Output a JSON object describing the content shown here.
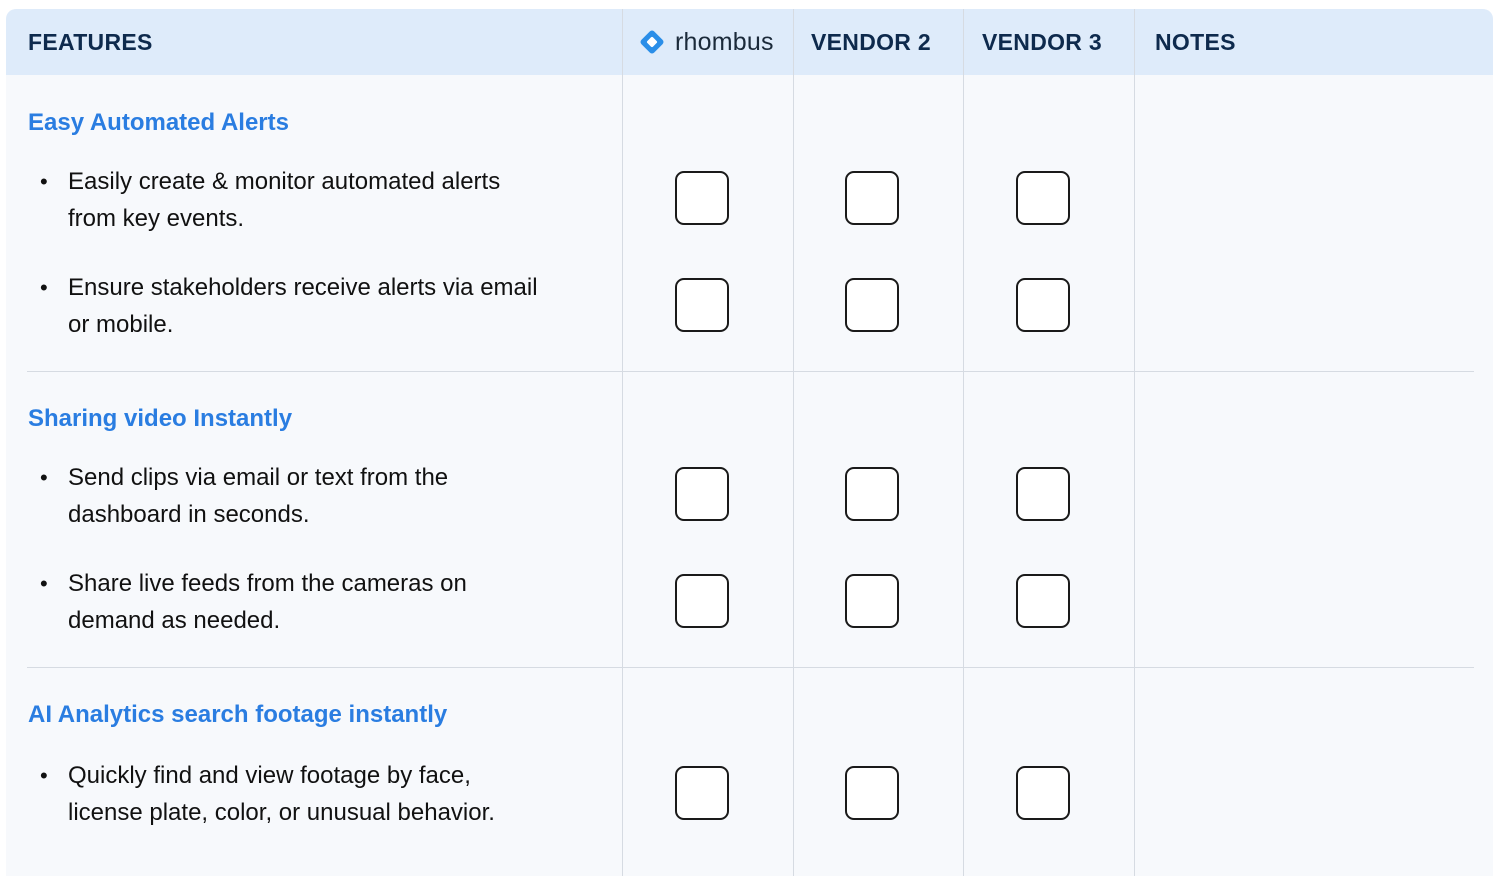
{
  "header": {
    "features": "FEATURES",
    "brand": "rhombus",
    "vendor2": "VENDOR 2",
    "vendor3": "VENDOR 3",
    "notes": "NOTES"
  },
  "sections": [
    {
      "title": "Easy Automated Alerts",
      "items": [
        {
          "line1": "Easily create & monitor automated alerts",
          "line2": "from key events."
        },
        {
          "line1": "Ensure stakeholders receive alerts via email",
          "line2": "or mobile."
        }
      ]
    },
    {
      "title": "Sharing video Instantly",
      "items": [
        {
          "line1": "Send clips via email or text from the",
          "line2": "dashboard in seconds."
        },
        {
          "line1": "Share live feeds from the cameras on",
          "line2": "demand as needed."
        }
      ]
    },
    {
      "title": "AI Analytics search footage instantly",
      "items": [
        {
          "line1": "Quickly find and view footage by face,",
          "line2": "license plate, color, or unusual behavior."
        }
      ]
    }
  ],
  "colors": {
    "header_bg": "#deebfa",
    "section_title": "#2a7de1",
    "brand_icon": "#2a8ee8"
  },
  "icons": {
    "brand": "rhombus-logo-icon",
    "checkbox": "empty-checkbox"
  }
}
